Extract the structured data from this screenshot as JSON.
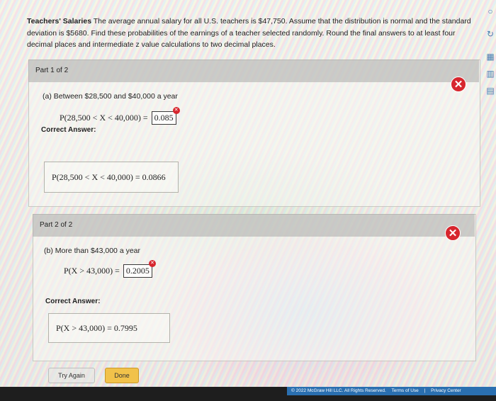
{
  "question": {
    "title": "Teachers' Salaries",
    "text": "The average annual salary for all U.S. teachers is $47,750. Assume that the distribution is normal and the standard deviation is $5680. Find these probabilities of the earnings of a teacher selected randomly. Round the final answers to at least four decimal places and intermediate z value calculations to two decimal places."
  },
  "part1": {
    "header": "Part 1 of 2",
    "prompt": "(a) Between $28,500 and $40,000 a year",
    "expression": "P(28,500 < X < 40,000) =",
    "answer": "0.085",
    "correct_label": "Correct Answer:",
    "correct_answer": "P(28,500 < X < 40,000) = 0.0866"
  },
  "part2": {
    "header": "Part 2 of 2",
    "prompt": "(b) More than $43,000 a year",
    "expression": "P(X > 43,000) =",
    "answer": "0.2005",
    "correct_label": "Correct Answer:",
    "correct_answer": "P(X > 43,000) = 0.7995"
  },
  "buttons": {
    "try_again": "Try Again",
    "done": "Done"
  },
  "footer": {
    "copyright": "© 2022 McGraw Hill LLC. All Rights Reserved.",
    "terms": "Terms of Use",
    "separator": "|",
    "privacy": "Privacy Center"
  },
  "icons": {
    "incorrect": "x-mark-icon",
    "error": "error-dot-icon"
  },
  "colors": {
    "error_red": "#d7262e",
    "done_button": "#f1c24a",
    "footer_blue": "#2a6fb0"
  }
}
